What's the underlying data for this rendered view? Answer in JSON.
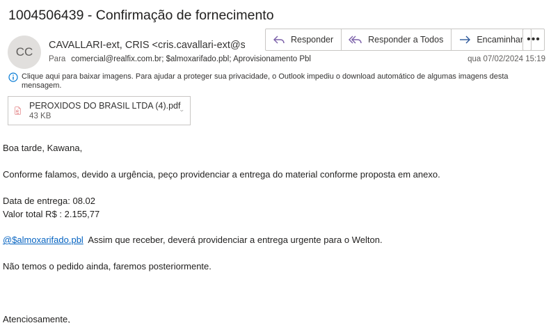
{
  "email": {
    "subject": "1004506439 - Confirmação de fornecimento",
    "avatar_initials": "CC",
    "sender": "CAVALLARI-ext, CRIS <cris.cavallari-ext@sc",
    "to_label": "Para",
    "recipients": "comercial@realfix.com.br; $almoxarifado.pbl; Aprovisionamento Pbl",
    "date": "qua 07/02/2024 15:19",
    "info_icon": "info-icon",
    "info_text": "Clique aqui para baixar imagens. Para ajudar a proteger sua privacidade, o Outlook impediu o download automático de algumas imagens desta mensagem.",
    "actions": {
      "reply": "Responder",
      "reply_all": "Responder a Todos",
      "forward": "Encaminhar",
      "more": "•••"
    },
    "attachment": {
      "icon": "pdf-file-icon",
      "name": "PEROXIDOS DO BRASIL LTDA (4).pdf",
      "size": "43 KB"
    },
    "body": {
      "greeting": "Boa tarde, Kawana,",
      "para1": "Conforme falamos, devido a urgência, peço providenciar a entrega do material conforme proposta em anexo.",
      "delivery": "Data de entrega: 08.02",
      "total": "Valor total R$ : 2.155,77",
      "mention": "@$almoxarifado.pbl",
      "mention_text": "  Assim que receber, deverá providenciar a entrega urgente para o Welton.",
      "para3": "Não temos o pedido ainda, faremos posteriormente.",
      "closing": "Atenciosamente,"
    }
  },
  "colors": {
    "accent": "#5c6bc0",
    "link": "#0563c1",
    "pdf_red": "#d13438",
    "border": "#c8c6c4"
  }
}
